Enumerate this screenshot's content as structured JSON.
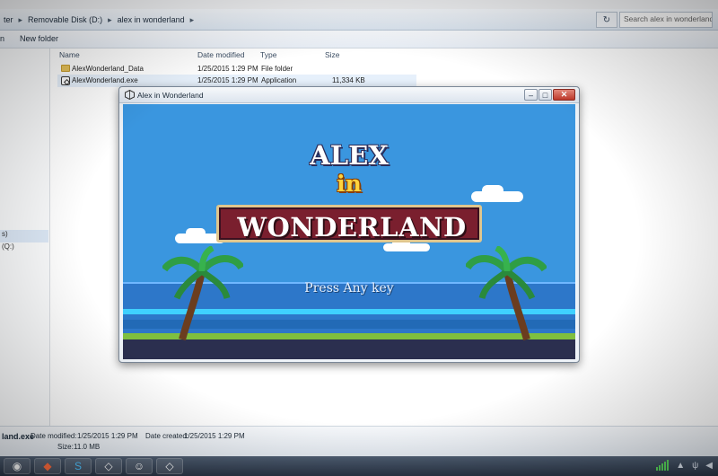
{
  "explorer": {
    "breadcrumb": [
      "ter",
      "Removable Disk (D:)",
      "alex in wonderland"
    ],
    "search_placeholder": "Search alex in wonderland",
    "new_folder_label": "New folder",
    "columns": {
      "name": "Name",
      "date": "Date modified",
      "type": "Type",
      "size": "Size"
    },
    "files": [
      {
        "name": "AlexWonderland_Data",
        "date": "1/25/2015 1:29 PM",
        "type": "File folder",
        "size": "",
        "icon": "folder-icon"
      },
      {
        "name": "AlexWonderland.exe",
        "date": "1/25/2015 1:29 PM",
        "type": "Application",
        "size": "11,334 KB",
        "icon": "unity-app-icon"
      }
    ],
    "nav_items": [
      "s)",
      "(Q:)"
    ],
    "details": {
      "name": "land.exe",
      "date_modified_label": "Date modified:",
      "date_modified": "1/25/2015 1:29 PM",
      "date_created_label": "Date created:",
      "date_created": "1/25/2015 1:29 PM",
      "size_label": "Size:",
      "size": "11.0 MB"
    }
  },
  "game_window": {
    "title": "Alex in Wonderland",
    "title_line1": "ALEX",
    "title_line2": "in",
    "title_line3": "WONDERLAND",
    "prompt": "Press Any key"
  },
  "taskbar": {
    "apps": [
      "chrome-icon",
      "git-icon",
      "skype-icon",
      "unity-icon",
      "chat-icon",
      "unity-icon"
    ]
  },
  "colors": {
    "sky": "#3a96df",
    "banner": "#7a1f2e",
    "title_gold": "#ffd33d"
  }
}
